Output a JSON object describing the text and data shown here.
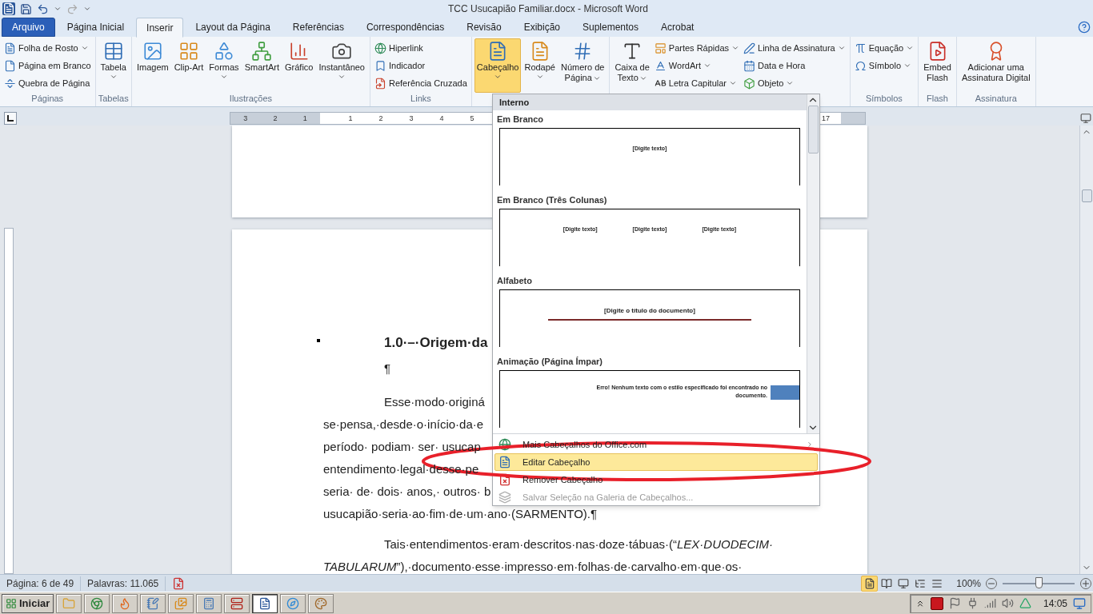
{
  "title_bar": {
    "title": "TCC Usucapião Familiar.docx - Microsoft Word"
  },
  "tabs": [
    {
      "label": "Arquivo",
      "kind": "file",
      "selected": false
    },
    {
      "label": "Página Inicial",
      "kind": "tab",
      "selected": false
    },
    {
      "label": "Inserir",
      "kind": "tab",
      "selected": true
    },
    {
      "label": "Layout da Página",
      "kind": "tab",
      "selected": false
    },
    {
      "label": "Referências",
      "kind": "tab",
      "selected": false
    },
    {
      "label": "Correspondências",
      "kind": "tab",
      "selected": false
    },
    {
      "label": "Revisão",
      "kind": "tab",
      "selected": false
    },
    {
      "label": "Exibição",
      "kind": "tab",
      "selected": false
    },
    {
      "label": "Suplementos",
      "kind": "tab",
      "selected": false
    },
    {
      "label": "Acrobat",
      "kind": "tab",
      "selected": false
    }
  ],
  "ribbon": {
    "groups": [
      {
        "label": "Páginas",
        "items": [
          {
            "kind": "stack",
            "items": [
              {
                "label": "Folha de Rosto",
                "dropdown": true
              },
              {
                "label": "Página em Branco",
                "dropdown": false
              },
              {
                "label": "Quebra de Página",
                "dropdown": false
              }
            ]
          }
        ]
      },
      {
        "label": "Tabelas",
        "items": [
          {
            "kind": "large",
            "lines": [
              "Tabela"
            ],
            "dropdown": true,
            "pressed": false
          }
        ]
      },
      {
        "label": "Ilustrações",
        "items": [
          {
            "kind": "large",
            "lines": [
              "Imagem"
            ],
            "dropdown": false,
            "pressed": false
          },
          {
            "kind": "large",
            "lines": [
              "Clip-Art"
            ],
            "dropdown": false,
            "pressed": false
          },
          {
            "kind": "large",
            "lines": [
              "Formas"
            ],
            "dropdown": true,
            "pressed": false
          },
          {
            "kind": "large",
            "lines": [
              "SmartArt"
            ],
            "dropdown": false,
            "pressed": false
          },
          {
            "kind": "large",
            "lines": [
              "Gráfico"
            ],
            "dropdown": false,
            "pressed": false
          },
          {
            "kind": "large",
            "lines": [
              "Instantâneo"
            ],
            "dropdown": true,
            "pressed": false
          }
        ]
      },
      {
        "label": "Links",
        "items": [
          {
            "kind": "stack",
            "items": [
              {
                "label": "Hiperlink",
                "dropdown": false
              },
              {
                "label": "Indicador",
                "dropdown": false
              },
              {
                "label": "Referência Cruzada",
                "dropdown": false
              }
            ]
          }
        ]
      },
      {
        "items": [
          {
            "kind": "large",
            "lines": [
              "Cabeçalho"
            ],
            "dropdown": true,
            "pressed": true
          },
          {
            "kind": "large",
            "lines": [
              "Rodapé"
            ],
            "dropdown": true,
            "pressed": false
          },
          {
            "kind": "large",
            "lines": [
              "Número de",
              "Página"
            ],
            "dropdown": true,
            "pressed": false
          }
        ]
      },
      {
        "items": [
          {
            "kind": "large",
            "lines": [
              "Caixa de",
              "Texto"
            ],
            "dropdown": true,
            "pressed": false
          },
          {
            "kind": "stack",
            "items": [
              {
                "label": "Partes Rápidas",
                "dropdown": true
              },
              {
                "label": "WordArt",
                "dropdown": true
              },
              {
                "label": "Letra Capitular",
                "dropdown": true
              }
            ]
          },
          {
            "kind": "stack",
            "items": [
              {
                "label": "Linha de Assinatura",
                "dropdown": true
              },
              {
                "label": "Data e Hora",
                "dropdown": false
              },
              {
                "label": "Objeto",
                "dropdown": true
              }
            ]
          }
        ]
      },
      {
        "label": "Símbolos",
        "items": [
          {
            "kind": "stack",
            "items": [
              {
                "label": "Equação",
                "dropdown": true
              },
              {
                "label": "Símbolo",
                "dropdown": true
              }
            ]
          }
        ]
      },
      {
        "label": "Flash",
        "items": [
          {
            "kind": "large",
            "lines": [
              "Embed",
              "Flash"
            ],
            "dropdown": false,
            "pressed": false
          }
        ]
      },
      {
        "label": "Assinatura",
        "items": [
          {
            "kind": "large",
            "lines": [
              "Adicionar uma",
              "Assinatura Digital"
            ],
            "dropdown": false,
            "pressed": false
          }
        ]
      }
    ]
  },
  "ruler": {
    "left_numbers": [
      "3",
      "2",
      "1"
    ],
    "right_numbers": [
      "1",
      "2",
      "3",
      "4",
      "5"
    ],
    "far_numbers": [
      "17"
    ]
  },
  "document": {
    "lines": [
      {
        "kind": "heading",
        "text": "1.0·–·Origem·da",
        "justified": false
      },
      {
        "kind": "indent",
        "text": "¶",
        "justified": false
      },
      {
        "kind": "indent",
        "text": "Esse·modo·originá",
        "justified": false
      },
      {
        "kind": "plain",
        "text": "se·pensa,·desde·o·início·da·e",
        "justified": false
      },
      {
        "kind": "plain",
        "text": "período· podiam· ser· usucap",
        "justified": false
      },
      {
        "kind": "plain",
        "text": "entendimento·legal·desse·pe",
        "justified": false
      },
      {
        "kind": "plain",
        "text": "seria· de· dois· anos,· outros· b",
        "justified": false
      },
      {
        "kind": "plain",
        "text": "usucapião·seria·ao·fim·de·um·ano·(SARMENTO).¶",
        "justified": false
      },
      {
        "kind": "indent",
        "text": "Tais·entendimentos·eram·descritos·nas·doze·tábuas·(“*LEX·DUODECIM·*",
        "justified": true
      },
      {
        "kind": "plain",
        "text": "*TABULARUM*”),·documento·esse·impresso·em·folhas·de·carvalho·em·que·os·",
        "justified": true
      }
    ]
  },
  "header_menu": {
    "section": "Interno",
    "gallery": [
      {
        "title": "Em Branco",
        "kind": "single",
        "texts": [
          "[Digite texto]"
        ]
      },
      {
        "title": "Em Branco (Três Colunas)",
        "kind": "columns",
        "texts": [
          "[Digite texto]",
          "[Digite texto]",
          "[Digite texto]"
        ]
      },
      {
        "title": "Alfabeto",
        "kind": "title-rule",
        "texts": [
          "[Digite o título do documento]"
        ]
      },
      {
        "title": "Animação (Página Ímpar)",
        "kind": "error-block",
        "texts": [
          "Erro! Nenhum texto com o estilo especificado foi encontrado no documento."
        ]
      }
    ],
    "items": [
      {
        "label": "Mais Cabeçalhos do Office.com",
        "submenu": true,
        "highlighted": false,
        "disabled": false
      },
      {
        "label": "Editar Cabeçalho",
        "submenu": false,
        "highlighted": true,
        "disabled": false
      },
      {
        "label": "Remover Cabeçalho",
        "submenu": false,
        "highlighted": false,
        "disabled": false
      },
      {
        "label": "Salvar Seleção na Galeria de Cabeçalhos...",
        "submenu": false,
        "highlighted": false,
        "disabled": true
      }
    ]
  },
  "status_bar": {
    "page": "Página: 6 de 49",
    "words": "Palavras: 11.065",
    "views": [
      {
        "selected": true
      },
      {
        "selected": false
      },
      {
        "selected": false
      },
      {
        "selected": false
      },
      {
        "selected": false
      }
    ],
    "zoom": {
      "label": "100%",
      "level": 0.5
    }
  },
  "taskbar": {
    "start": "Iniciar",
    "apps": [
      {
        "selected": false
      },
      {
        "selected": false
      },
      {
        "selected": false
      },
      {
        "selected": false
      },
      {
        "selected": false
      },
      {
        "selected": false
      },
      {
        "selected": false
      },
      {
        "selected": true
      },
      {
        "selected": false
      },
      {
        "selected": false
      }
    ],
    "clock": "14:05"
  }
}
